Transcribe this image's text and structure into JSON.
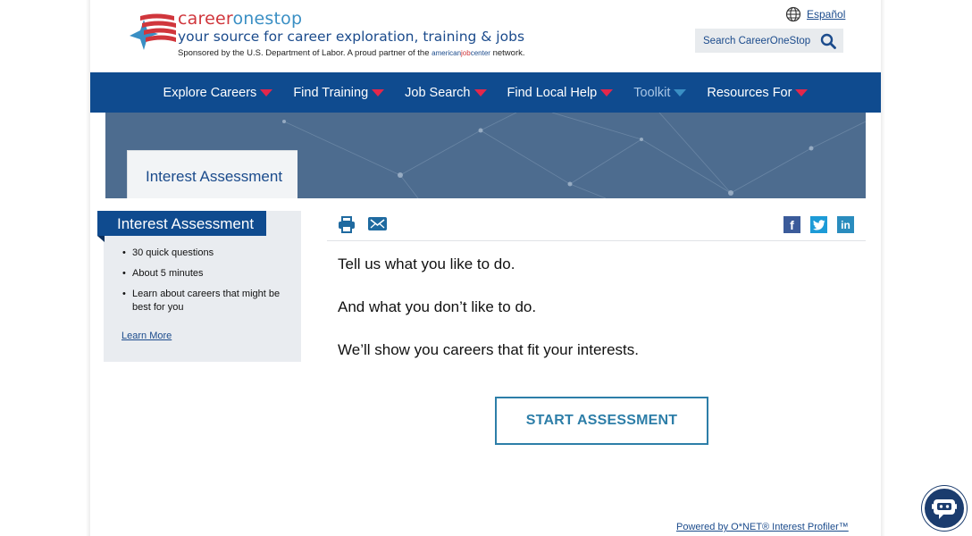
{
  "header": {
    "brand_part1": "career",
    "brand_part2": "onestop",
    "tagline": "your source for career exploration, training & jobs",
    "sponsor_prefix": "Sponsored by the U.S. Department of Labor. A proud partner of the",
    "sponsor_ajc_1": "american",
    "sponsor_ajc_2": "job",
    "sponsor_ajc_3": "center",
    "sponsor_suffix": "network.",
    "language_link": "Español",
    "search_label": "Search CareerOneStop"
  },
  "nav": {
    "items": [
      {
        "label": "Explore Careers"
      },
      {
        "label": "Find Training"
      },
      {
        "label": "Job Search"
      },
      {
        "label": "Find Local Help"
      },
      {
        "label": "Toolkit"
      },
      {
        "label": "Resources For"
      }
    ]
  },
  "hero": {
    "tab_title": "Interest Assessment"
  },
  "sidebar": {
    "title": "Interest Assessment",
    "bullets": [
      "30 quick questions",
      "About 5 minutes",
      "Learn about careers that might be best for you"
    ],
    "link": "Learn More"
  },
  "main": {
    "line1": "Tell us what you like to do.",
    "line2": "And what you don’t like to do.",
    "line3": "We’ll show you careers that fit your interests.",
    "button": "START ASSESSMENT",
    "powered_by": "Powered by O*NET® Interest Profiler™"
  },
  "social": {
    "facebook": "f",
    "linkedin": "in"
  },
  "colors": {
    "nav_bg": "#0f4b8f",
    "accent_red": "#e3274b",
    "button_border": "#2d7ea8",
    "hero_bg": "#4d6c8f"
  }
}
